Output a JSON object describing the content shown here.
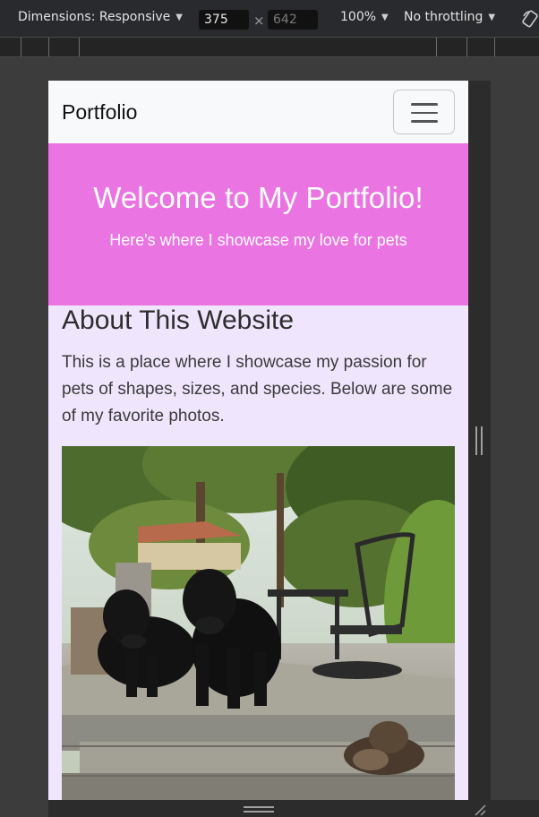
{
  "devtools": {
    "dimensions_label": "Dimensions: Responsive",
    "width_value": "375",
    "height_value": "642",
    "zoom_label": "100%",
    "throttling_label": "No throttling"
  },
  "site": {
    "brand": "Portfolio",
    "hero": {
      "title": "Welcome to My Portfolio!",
      "subtitle": "Here's where I showcase my love for pets",
      "background": "#ea74e1"
    },
    "about": {
      "title": "About This Website",
      "text": "This is a place where I showcase my passion for pets of shapes, sizes, and species. Below are some of my favorite photos."
    },
    "page_background": "#efe6fe"
  }
}
